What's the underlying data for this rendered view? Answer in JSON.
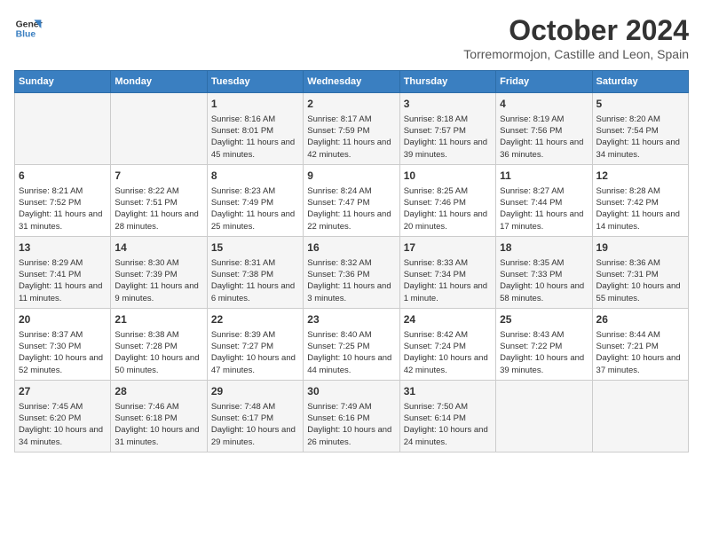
{
  "header": {
    "logo_line1": "General",
    "logo_line2": "Blue",
    "month": "October 2024",
    "location": "Torremormojon, Castille and Leon, Spain"
  },
  "days_of_week": [
    "Sunday",
    "Monday",
    "Tuesday",
    "Wednesday",
    "Thursday",
    "Friday",
    "Saturday"
  ],
  "weeks": [
    [
      {
        "day": "",
        "info": ""
      },
      {
        "day": "",
        "info": ""
      },
      {
        "day": "1",
        "info": "Sunrise: 8:16 AM\nSunset: 8:01 PM\nDaylight: 11 hours and 45 minutes."
      },
      {
        "day": "2",
        "info": "Sunrise: 8:17 AM\nSunset: 7:59 PM\nDaylight: 11 hours and 42 minutes."
      },
      {
        "day": "3",
        "info": "Sunrise: 8:18 AM\nSunset: 7:57 PM\nDaylight: 11 hours and 39 minutes."
      },
      {
        "day": "4",
        "info": "Sunrise: 8:19 AM\nSunset: 7:56 PM\nDaylight: 11 hours and 36 minutes."
      },
      {
        "day": "5",
        "info": "Sunrise: 8:20 AM\nSunset: 7:54 PM\nDaylight: 11 hours and 34 minutes."
      }
    ],
    [
      {
        "day": "6",
        "info": "Sunrise: 8:21 AM\nSunset: 7:52 PM\nDaylight: 11 hours and 31 minutes."
      },
      {
        "day": "7",
        "info": "Sunrise: 8:22 AM\nSunset: 7:51 PM\nDaylight: 11 hours and 28 minutes."
      },
      {
        "day": "8",
        "info": "Sunrise: 8:23 AM\nSunset: 7:49 PM\nDaylight: 11 hours and 25 minutes."
      },
      {
        "day": "9",
        "info": "Sunrise: 8:24 AM\nSunset: 7:47 PM\nDaylight: 11 hours and 22 minutes."
      },
      {
        "day": "10",
        "info": "Sunrise: 8:25 AM\nSunset: 7:46 PM\nDaylight: 11 hours and 20 minutes."
      },
      {
        "day": "11",
        "info": "Sunrise: 8:27 AM\nSunset: 7:44 PM\nDaylight: 11 hours and 17 minutes."
      },
      {
        "day": "12",
        "info": "Sunrise: 8:28 AM\nSunset: 7:42 PM\nDaylight: 11 hours and 14 minutes."
      }
    ],
    [
      {
        "day": "13",
        "info": "Sunrise: 8:29 AM\nSunset: 7:41 PM\nDaylight: 11 hours and 11 minutes."
      },
      {
        "day": "14",
        "info": "Sunrise: 8:30 AM\nSunset: 7:39 PM\nDaylight: 11 hours and 9 minutes."
      },
      {
        "day": "15",
        "info": "Sunrise: 8:31 AM\nSunset: 7:38 PM\nDaylight: 11 hours and 6 minutes."
      },
      {
        "day": "16",
        "info": "Sunrise: 8:32 AM\nSunset: 7:36 PM\nDaylight: 11 hours and 3 minutes."
      },
      {
        "day": "17",
        "info": "Sunrise: 8:33 AM\nSunset: 7:34 PM\nDaylight: 11 hours and 1 minute."
      },
      {
        "day": "18",
        "info": "Sunrise: 8:35 AM\nSunset: 7:33 PM\nDaylight: 10 hours and 58 minutes."
      },
      {
        "day": "19",
        "info": "Sunrise: 8:36 AM\nSunset: 7:31 PM\nDaylight: 10 hours and 55 minutes."
      }
    ],
    [
      {
        "day": "20",
        "info": "Sunrise: 8:37 AM\nSunset: 7:30 PM\nDaylight: 10 hours and 52 minutes."
      },
      {
        "day": "21",
        "info": "Sunrise: 8:38 AM\nSunset: 7:28 PM\nDaylight: 10 hours and 50 minutes."
      },
      {
        "day": "22",
        "info": "Sunrise: 8:39 AM\nSunset: 7:27 PM\nDaylight: 10 hours and 47 minutes."
      },
      {
        "day": "23",
        "info": "Sunrise: 8:40 AM\nSunset: 7:25 PM\nDaylight: 10 hours and 44 minutes."
      },
      {
        "day": "24",
        "info": "Sunrise: 8:42 AM\nSunset: 7:24 PM\nDaylight: 10 hours and 42 minutes."
      },
      {
        "day": "25",
        "info": "Sunrise: 8:43 AM\nSunset: 7:22 PM\nDaylight: 10 hours and 39 minutes."
      },
      {
        "day": "26",
        "info": "Sunrise: 8:44 AM\nSunset: 7:21 PM\nDaylight: 10 hours and 37 minutes."
      }
    ],
    [
      {
        "day": "27",
        "info": "Sunrise: 7:45 AM\nSunset: 6:20 PM\nDaylight: 10 hours and 34 minutes."
      },
      {
        "day": "28",
        "info": "Sunrise: 7:46 AM\nSunset: 6:18 PM\nDaylight: 10 hours and 31 minutes."
      },
      {
        "day": "29",
        "info": "Sunrise: 7:48 AM\nSunset: 6:17 PM\nDaylight: 10 hours and 29 minutes."
      },
      {
        "day": "30",
        "info": "Sunrise: 7:49 AM\nSunset: 6:16 PM\nDaylight: 10 hours and 26 minutes."
      },
      {
        "day": "31",
        "info": "Sunrise: 7:50 AM\nSunset: 6:14 PM\nDaylight: 10 hours and 24 minutes."
      },
      {
        "day": "",
        "info": ""
      },
      {
        "day": "",
        "info": ""
      }
    ]
  ]
}
